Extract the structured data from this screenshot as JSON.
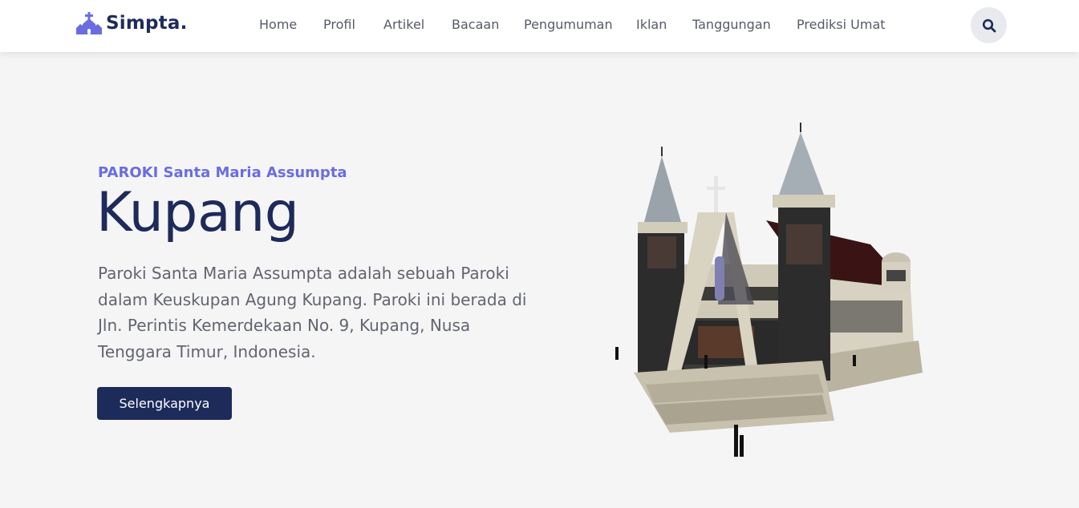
{
  "brand": {
    "name": "Simpta.",
    "icon": "church-icon",
    "color": "#6a6de0"
  },
  "nav": {
    "items": [
      {
        "label": "Home"
      },
      {
        "label": "Profil"
      },
      {
        "label": "Artikel"
      },
      {
        "label": "Bacaan"
      },
      {
        "label": "Pengumuman"
      },
      {
        "label": "Iklan"
      },
      {
        "label": "Tanggungan"
      },
      {
        "label": "Prediksi Umat"
      }
    ],
    "search_icon": "search-icon"
  },
  "hero": {
    "subtitle": "PAROKI Santa Maria Assumpta",
    "title": "Kupang",
    "description": "Paroki Santa Maria Assumpta adalah sebuah Paroki dalam Keuskupan Agung Kupang. Paroki ini berada di Jln. Perintis Kemerdekaan No. 9, Kupang, Nusa Tenggara Timur, Indonesia.",
    "button_label": "Selengkapnya",
    "image": "church-3d-model-illustration"
  },
  "colors": {
    "accent": "#6a6de0",
    "navy": "#1c2b5a",
    "background": "#f5f5f6"
  }
}
